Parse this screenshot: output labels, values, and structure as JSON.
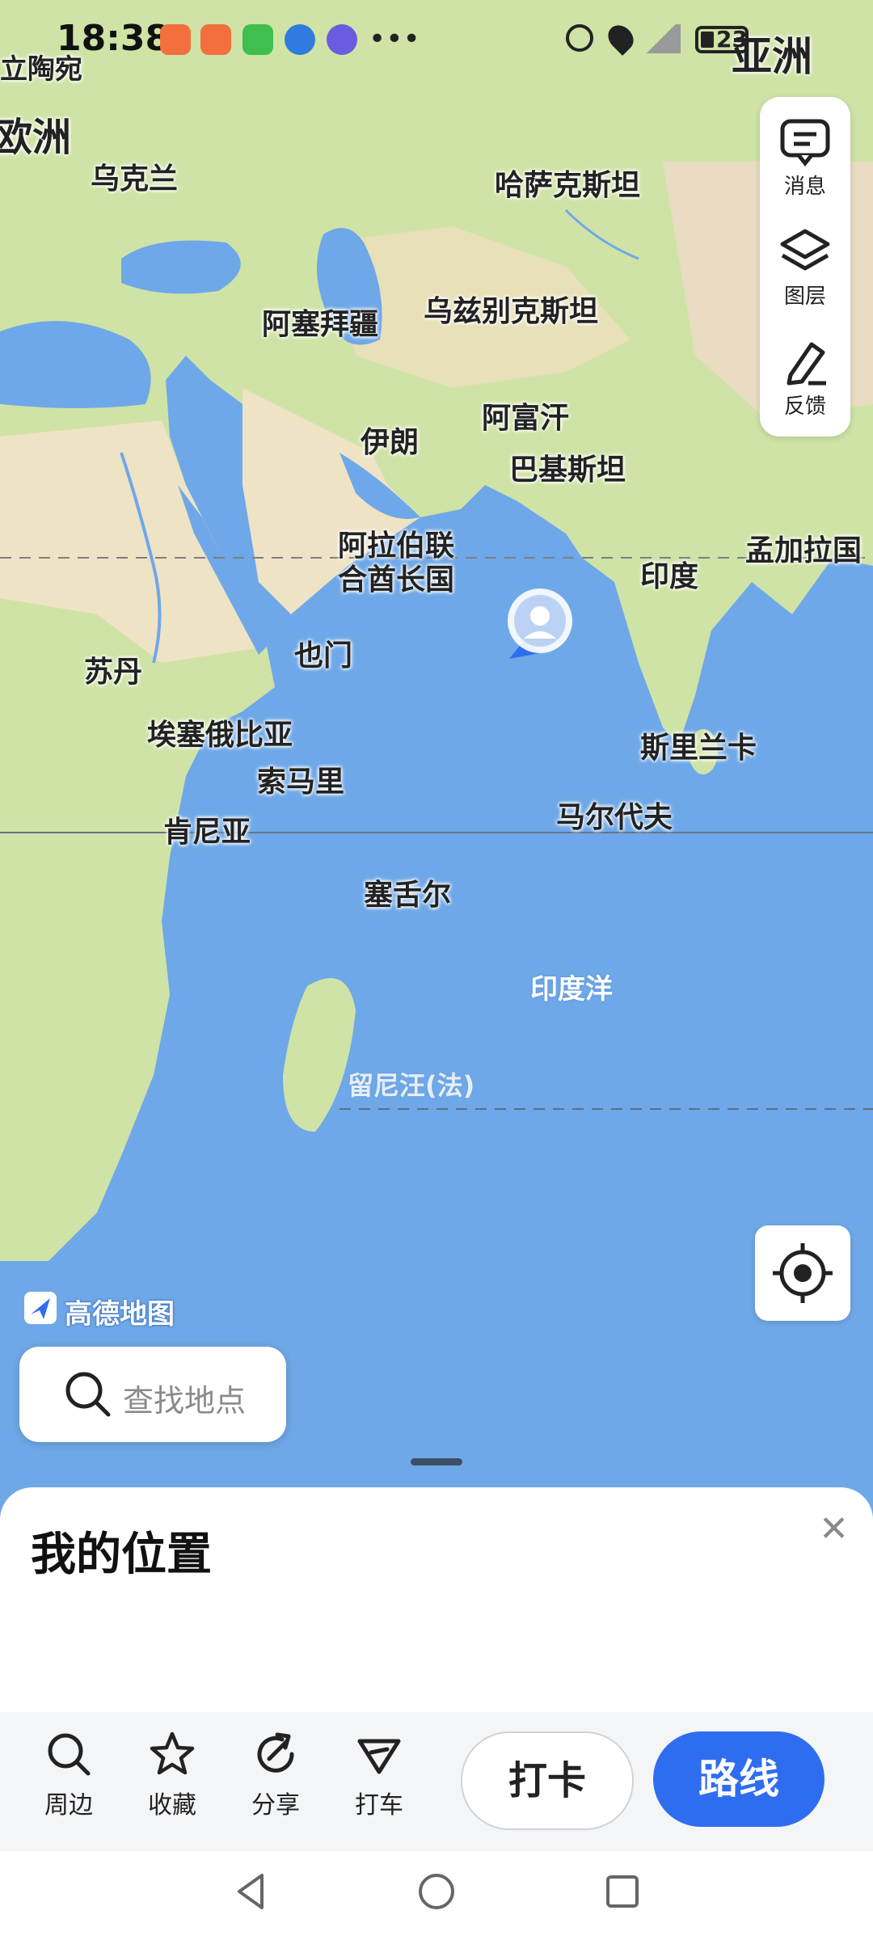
{
  "status_bar": {
    "time": "18:38",
    "battery": "23"
  },
  "map": {
    "labels": [
      {
        "id": "lithuania",
        "text": "立陶宛"
      },
      {
        "id": "europe",
        "text": "欧洲"
      },
      {
        "id": "ukraine",
        "text": "乌克兰"
      },
      {
        "id": "kazakhstan",
        "text": "哈萨克斯坦"
      },
      {
        "id": "asia",
        "text": "亚洲"
      },
      {
        "id": "azerbaijan",
        "text": "阿塞拜疆"
      },
      {
        "id": "uzbekistan",
        "text": "乌兹别克斯坦"
      },
      {
        "id": "iran",
        "text": "伊朗"
      },
      {
        "id": "afghanistan",
        "text": "阿富汗"
      },
      {
        "id": "pakistan",
        "text": "巴基斯坦"
      },
      {
        "id": "uae_1",
        "text": "阿拉伯联"
      },
      {
        "id": "uae_2",
        "text": "合酋长国"
      },
      {
        "id": "india",
        "text": "印度"
      },
      {
        "id": "bangladesh",
        "text": "孟加拉国"
      },
      {
        "id": "sudan",
        "text": "苏丹"
      },
      {
        "id": "yemen",
        "text": "也门"
      },
      {
        "id": "ethiopia",
        "text": "埃塞俄比亚"
      },
      {
        "id": "somalia",
        "text": "索马里"
      },
      {
        "id": "srilanka",
        "text": "斯里兰卡"
      },
      {
        "id": "kenya",
        "text": "肯尼亚"
      },
      {
        "id": "maldives",
        "text": "马尔代夫"
      },
      {
        "id": "seychelles",
        "text": "塞舌尔"
      },
      {
        "id": "indian_ocean",
        "text": "印度洋"
      },
      {
        "id": "reunion",
        "text": "留尼汪(法)"
      }
    ],
    "logo_text": "高德地图",
    "accent_color": "#2f6df0"
  },
  "toolbar": {
    "messages": "消息",
    "layers": "图层",
    "feedback": "反馈"
  },
  "search": {
    "placeholder": "查找地点"
  },
  "sheet": {
    "title": "我的位置",
    "actions": {
      "nearby": "周边",
      "favorite": "收藏",
      "share": "分享",
      "taxi": "打车"
    },
    "checkin": "打卡",
    "route": "路线"
  }
}
